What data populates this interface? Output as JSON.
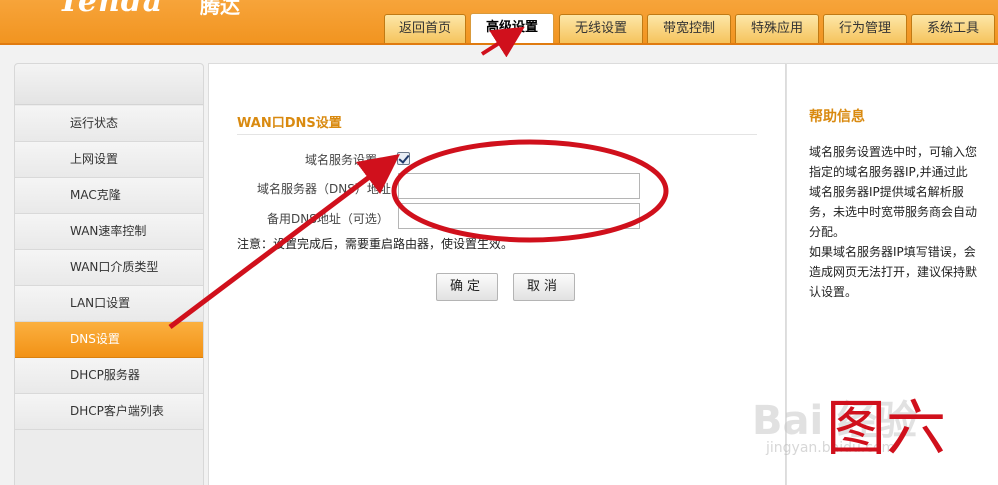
{
  "brand": {
    "logo": "Tenda",
    "logo_cn": "腾达"
  },
  "nav": {
    "tabs": [
      {
        "label": "返回首页"
      },
      {
        "label": "高级设置"
      },
      {
        "label": "无线设置"
      },
      {
        "label": "带宽控制"
      },
      {
        "label": "特殊应用"
      },
      {
        "label": "行为管理"
      },
      {
        "label": "系统工具"
      }
    ],
    "active": "高级设置"
  },
  "sidebar": {
    "items": [
      {
        "label": "运行状态"
      },
      {
        "label": "上网设置"
      },
      {
        "label": "MAC克隆"
      },
      {
        "label": "WAN速率控制"
      },
      {
        "label": "WAN口介质类型"
      },
      {
        "label": "LAN口设置"
      },
      {
        "label": "DNS设置"
      },
      {
        "label": "DHCP服务器"
      },
      {
        "label": "DHCP客户端列表"
      }
    ],
    "active": "DNS设置"
  },
  "main": {
    "section_title": "WAN口DNS设置",
    "dns_enable_label": "域名服务设置",
    "dns_enable_checked": true,
    "primary_dns_label": "域名服务器（DNS）地址",
    "primary_dns_value": "",
    "secondary_dns_label": "备用DNS地址（可选）",
    "secondary_dns_value": "",
    "note": "注意：设置完成后，需要重启路由器，使设置生效。",
    "ok_button": "确定",
    "cancel_button": "取消"
  },
  "help": {
    "title": "帮助信息",
    "text": "域名服务设置选中时，可输入您指定的域名服务器IP,并通过此域名服务器IP提供域名解析服务，未选中时宽带服务商会自动分配。\n如果域名服务器IP填写错误，会造成网页无法打开，建议保持默认设置。"
  },
  "overlay": {
    "watermark": "Bai 经验",
    "watermark_sub": "jingyan.baidu.com",
    "figure_label": "图六",
    "annotation_color": "#d0101c"
  }
}
